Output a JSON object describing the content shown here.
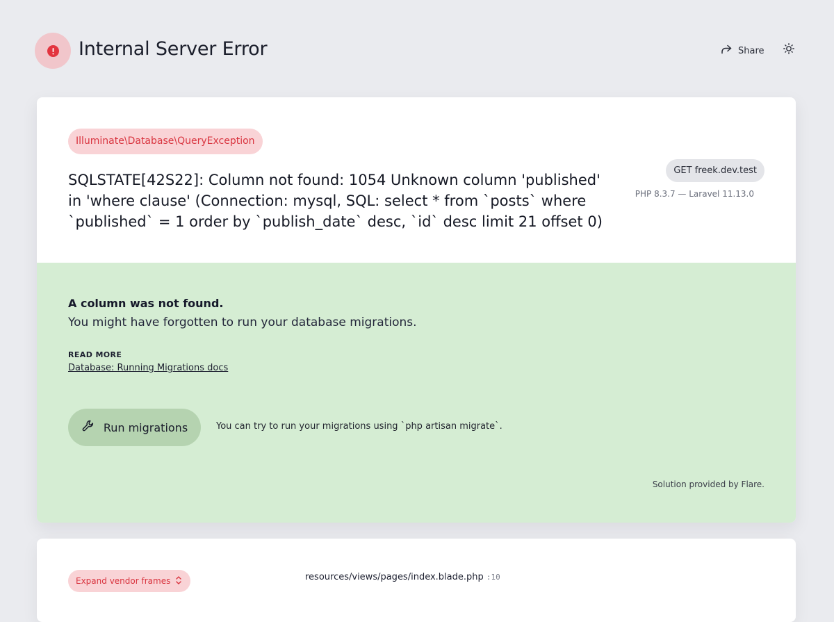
{
  "header": {
    "title": "Internal Server Error",
    "share_label": "Share"
  },
  "exception": {
    "class": "Illuminate\\Database\\QueryException",
    "message": "SQLSTATE[42S22]: Column not found: 1054 Unknown column 'published' in 'where clause' (Connection: mysql, SQL: select * from `posts` where `published` = 1 order by `publish_date` desc, `id` desc limit 21 offset 0)",
    "request": "GET freek.dev.test",
    "versions": "PHP 8.3.7 — Laravel 11.13.0"
  },
  "solution": {
    "title": "A column was not found.",
    "description": "You might have forgotten to run your database migrations.",
    "read_more_label": "READ MORE",
    "link_label": "Database: Running Migrations docs",
    "button_label": "Run migrations",
    "hint": "You can try to run your migrations using `php artisan migrate`.",
    "provided_by": "Solution provided by Flare."
  },
  "stack": {
    "expand_label": "Expand vendor frames",
    "frame_path": "resources/views/pages/index.blade.php",
    "frame_line": ":10"
  },
  "colors": {
    "error": "#e3343f",
    "solution_bg": "#d5edd3",
    "badge_bg": "#f9d3d6"
  }
}
